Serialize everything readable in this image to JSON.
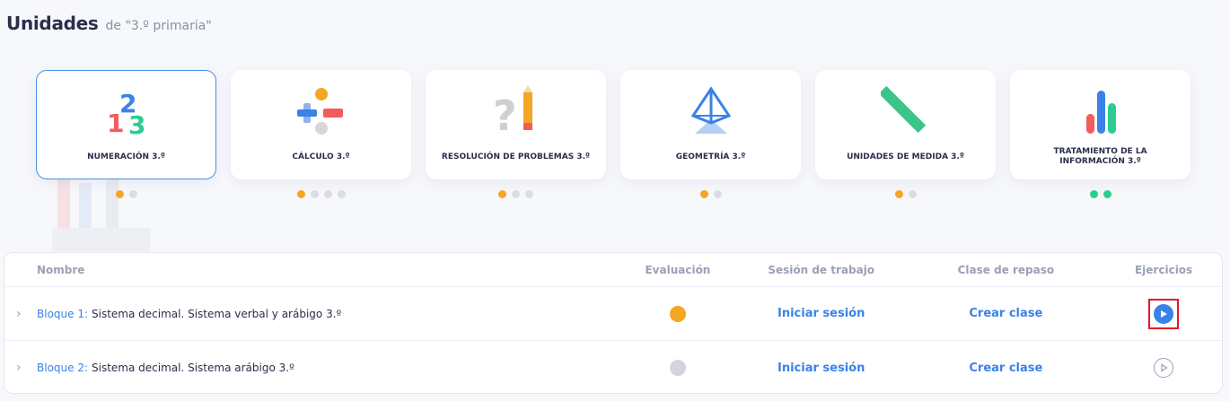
{
  "header": {
    "title": "Unidades",
    "subtitle": "de \"3.º primaria\""
  },
  "units": [
    {
      "title": "NUMERACIÓN 3.º",
      "icon": "numbers-123-icon",
      "active": true,
      "dots": [
        "orange",
        "gray"
      ]
    },
    {
      "title": "CÁLCULO 3.º",
      "icon": "plus-minus-icon",
      "active": false,
      "dots": [
        "orange",
        "gray",
        "gray",
        "gray"
      ]
    },
    {
      "title": "RESOLUCIÓN DE PROBLEMAS 3.º",
      "icon": "question-pencil-icon",
      "active": false,
      "dots": [
        "orange",
        "gray",
        "gray"
      ]
    },
    {
      "title": "GEOMETRÍA 3.º",
      "icon": "pyramid-icon",
      "active": false,
      "dots": [
        "orange",
        "gray"
      ]
    },
    {
      "title": "UNIDADES DE MEDIDA 3.º",
      "icon": "ruler-icon",
      "active": false,
      "dots": [
        "orange",
        "gray"
      ]
    },
    {
      "title": "TRATAMIENTO DE LA INFORMACIÓN 3.º",
      "icon": "bar-chart-icon",
      "active": false,
      "dots": [
        "green",
        "green"
      ]
    }
  ],
  "table": {
    "headers": {
      "name": "Nombre",
      "eval": "Evaluación",
      "session": "Sesión de trabajo",
      "review": "Clase de repaso",
      "exercises": "Ejercicios"
    },
    "rows": [
      {
        "block": "Bloque 1:",
        "name": "Sistema decimal. Sistema verbal y arábigo 3.º",
        "eval_color": "#f5a623",
        "session": "Iniciar sesión",
        "review": "Crear clase",
        "exercise_icon": "play-filled-icon"
      },
      {
        "block": "Bloque 2:",
        "name": "Sistema decimal. Sistema arábigo 3.º",
        "eval_color": "#d4d5da",
        "session": "Iniciar sesión",
        "review": "Crear clase",
        "exercise_icon": "play-outline-icon"
      }
    ]
  },
  "colors": {
    "accent": "#3b82e8",
    "orange": "#f5a623",
    "green": "#2ecc8f",
    "highlight": "#e4162a"
  }
}
